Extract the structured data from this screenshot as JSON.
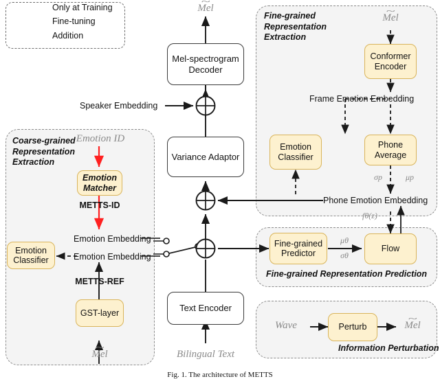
{
  "figure": {
    "caption": "Fig. 1. The architecture of METTS",
    "colors": {
      "node_fill": "#fdf1cf",
      "node_border": "#d9b45a",
      "panel_bg": "#f4f4f4",
      "panel_border": "#8c8c8c",
      "finetune_arrow": "#ff2020",
      "text": "#111111",
      "muted_text": "#8a8a8a"
    }
  },
  "legend": {
    "items": [
      {
        "glyph": "dashed-line",
        "label": "Only at Training"
      },
      {
        "glyph": "red-arrow",
        "label": "Fine-tuning"
      },
      {
        "glyph": "circle-plus",
        "label": "Addition"
      }
    ]
  },
  "backbone": {
    "output_label": "Mel",
    "input_label": "Bilingual Text",
    "speaker_label": "Speaker Embedding",
    "boxes": [
      {
        "id": "mel-decoder",
        "label": "Mel-spectrogram\nDecoder"
      },
      {
        "id": "variance-adaptor",
        "label": "Variance Adaptor"
      },
      {
        "id": "text-encoder",
        "label": "Text Encoder"
      }
    ],
    "adders": [
      "speaker-adder",
      "phone-adder",
      "emotion-adder"
    ]
  },
  "coarse_panel": {
    "title": "Coarse-grained\nRepresentation\nExtraction",
    "input_label": "Emotion ID",
    "ref_input_label": "Mel",
    "nodes": [
      {
        "id": "emotion-matcher",
        "label": "Emotion\nMatcher"
      },
      {
        "id": "emotion-classifier-coarse",
        "label": "Emotion\nClassifier"
      },
      {
        "id": "gst-layer",
        "label": "GST-layer"
      }
    ],
    "edge_labels": [
      "METTS-ID",
      "METTS-REF"
    ],
    "embedding_labels": [
      "Emotion Embedding",
      "Emotion Embedding"
    ]
  },
  "fine_extraction_panel": {
    "title": "Fine-grained\nRepresentation\nExtraction",
    "input_label": "Mel",
    "nodes": [
      {
        "id": "conformer-encoder",
        "label": "Conformer\nEncoder"
      },
      {
        "id": "emotion-classifier-fine",
        "label": "Emotion\nClassifier"
      },
      {
        "id": "phone-average",
        "label": "Phone\nAverage"
      }
    ],
    "frame_embedding_label": "Frame Emotion Embedding",
    "phone_embedding_label": "Phone Emotion Embedding",
    "stat_labels": [
      "σp",
      "μp"
    ],
    "flow_function_label": "fθ(z)"
  },
  "fine_prediction_panel": {
    "title": "Fine-grained  Representation Prediction",
    "nodes": [
      {
        "id": "fine-grained-predictor",
        "label": "Fine-grained\nPredictor"
      },
      {
        "id": "flow",
        "label": "Flow"
      }
    ],
    "stat_labels": [
      "μθ",
      "σθ"
    ]
  },
  "perturbation_panel": {
    "title": "Information Perturbation",
    "input_label": "Wave",
    "output_label": "Mel",
    "nodes": [
      {
        "id": "perturb",
        "label": "Perturb"
      }
    ]
  }
}
